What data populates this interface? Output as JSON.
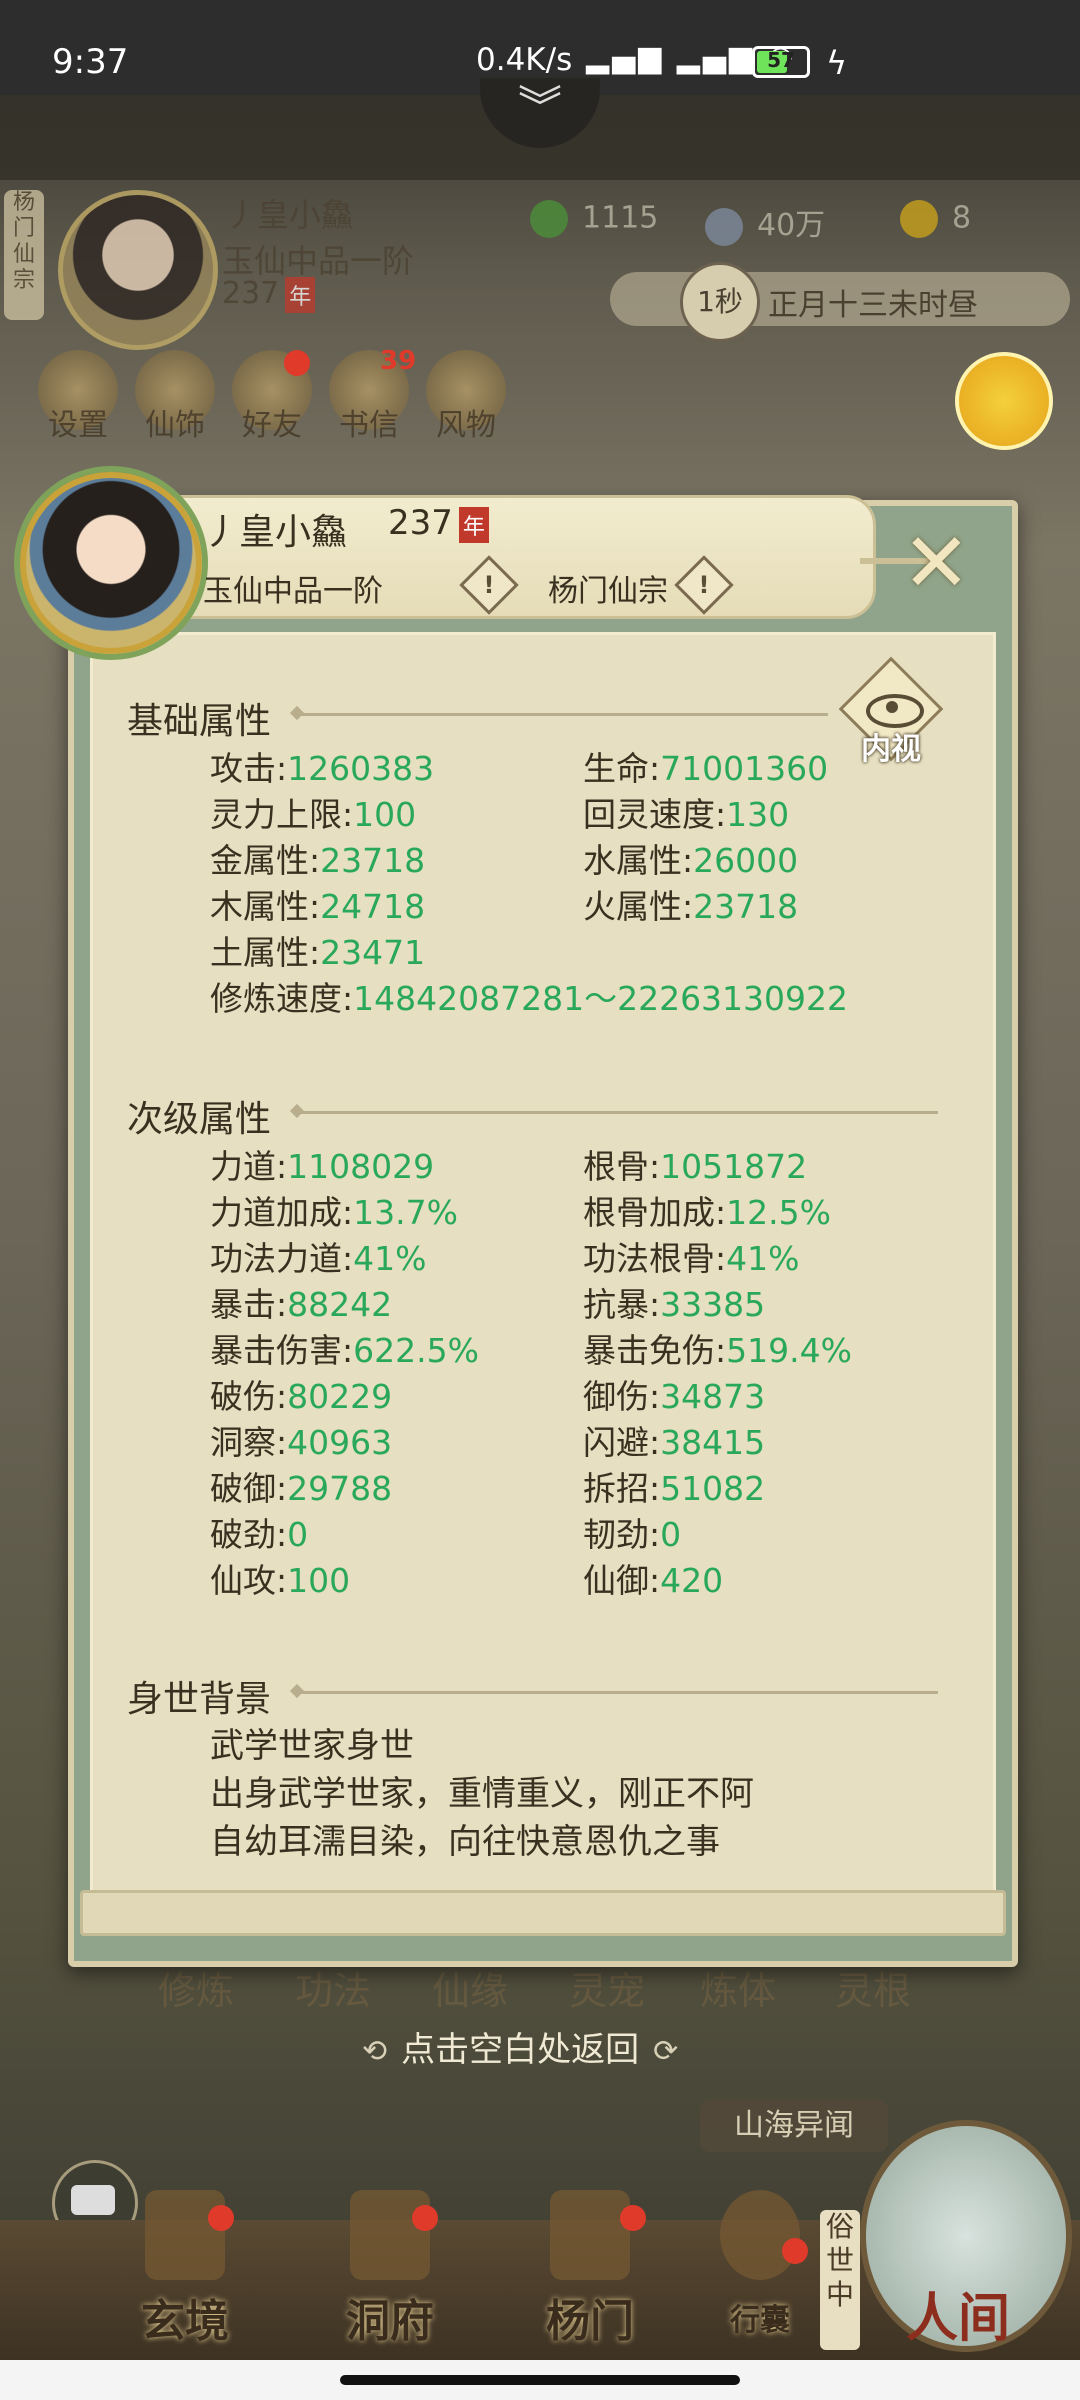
{
  "status_bar": {
    "time": "9:37",
    "network_speed": "0.4K/s",
    "battery_level": "57",
    "battery_fraction": 0.57
  },
  "background_hud": {
    "sect_badge": "杨门仙宗",
    "player": {
      "name": "丿皇小鱻",
      "rank": "玉仙中品一阶",
      "age": "237",
      "age_unit": "年"
    },
    "resources": [
      {
        "icon": "jade-leaf-icon",
        "value": "1115"
      },
      {
        "icon": "coin-icon",
        "value": "40万"
      },
      {
        "icon": "gold-trophy-icon",
        "value": "8"
      }
    ],
    "time_speed": "1秒",
    "game_time": "正月十三未时昼",
    "top_menu": [
      {
        "label": "设置",
        "icon": "settings-icon"
      },
      {
        "label": "仙饰",
        "icon": "costume-icon"
      },
      {
        "label": "好友",
        "icon": "friends-icon",
        "dot": true
      },
      {
        "label": "书信",
        "icon": "letters-icon",
        "badge": "39"
      },
      {
        "label": "风物",
        "icon": "scenery-icon"
      }
    ],
    "tabs": [
      "修炼",
      "功法",
      "仙缘",
      "灵宠",
      "炼体",
      "灵根"
    ],
    "back_hint": "点击空白处返回",
    "news_button": "山海异闻",
    "bottom_nav": [
      {
        "label": "玄境",
        "dot": true
      },
      {
        "label": "洞府",
        "dot": true
      },
      {
        "label": "杨门",
        "dot": true
      },
      {
        "label": "行囊",
        "dot": true
      }
    ],
    "secular_label": "俗世中",
    "world_label": "人间"
  },
  "dialog": {
    "name": "丿皇小鱻",
    "age": "237",
    "age_unit": "年",
    "rank": "玉仙中品一阶",
    "sect": "杨门仙宗",
    "inner_view_label": "内视",
    "basic_title": "基础属性",
    "basic_stats": [
      {
        "label": "攻击:",
        "value": "1260383"
      },
      {
        "label": "生命:",
        "value": "71001360"
      },
      {
        "label": "灵力上限:",
        "value": "100"
      },
      {
        "label": "回灵速度:",
        "value": "130"
      },
      {
        "label": "金属性:",
        "value": "23718"
      },
      {
        "label": "水属性:",
        "value": "26000"
      },
      {
        "label": "木属性:",
        "value": "24718"
      },
      {
        "label": "火属性:",
        "value": "23718"
      },
      {
        "label": "土属性:",
        "value": "23471"
      }
    ],
    "cultivation_speed": {
      "label": "修炼速度:",
      "value": "14842087281～22263130922"
    },
    "secondary_title": "次级属性",
    "secondary_stats": [
      {
        "label": "力道:",
        "value": "1108029"
      },
      {
        "label": "根骨:",
        "value": "1051872"
      },
      {
        "label": "力道加成:",
        "value": "13.7%"
      },
      {
        "label": "根骨加成:",
        "value": "12.5%"
      },
      {
        "label": "功法力道:",
        "value": "41%"
      },
      {
        "label": "功法根骨:",
        "value": "41%"
      },
      {
        "label": "暴击:",
        "value": "88242"
      },
      {
        "label": "抗暴:",
        "value": "33385"
      },
      {
        "label": "暴击伤害:",
        "value": "622.5%"
      },
      {
        "label": "暴击免伤:",
        "value": "519.4%"
      },
      {
        "label": "破伤:",
        "value": "80229"
      },
      {
        "label": "御伤:",
        "value": "34873"
      },
      {
        "label": "洞察:",
        "value": "40963"
      },
      {
        "label": "闪避:",
        "value": "38415"
      },
      {
        "label": "破御:",
        "value": "29788"
      },
      {
        "label": "拆招:",
        "value": "51082"
      },
      {
        "label": "破劲:",
        "value": "0"
      },
      {
        "label": "韧劲:",
        "value": "0"
      },
      {
        "label": "仙攻:",
        "value": "100"
      },
      {
        "label": "仙御:",
        "value": "420"
      }
    ],
    "background_title": "身世背景",
    "background_lines": [
      "武学世家身世",
      "出身武学世家，重情重义，刚正不阿",
      "自幼耳濡目染，向往快意恩仇之事"
    ]
  }
}
